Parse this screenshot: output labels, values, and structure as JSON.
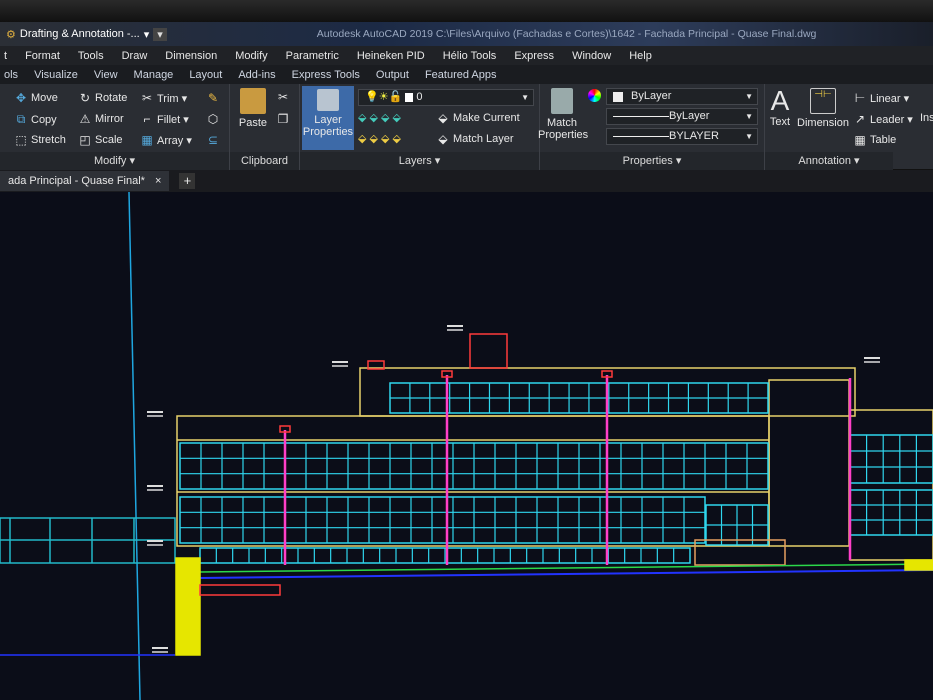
{
  "workspace": {
    "name": "Drafting & Annotation -..."
  },
  "window_title": "Autodesk AutoCAD 2019    C:\\Files\\Arquivo (Fachadas e Cortes)\\1642 - Fachada Principal - Quase Final.dwg",
  "menu": [
    "t",
    "Format",
    "Tools",
    "Draw",
    "Dimension",
    "Modify",
    "Parametric",
    "Heineken PID",
    "Hélio Tools",
    "Express",
    "Window",
    "Help"
  ],
  "ribbon_tabs": [
    "ols",
    "Visualize",
    "View",
    "Manage",
    "Layout",
    "Add-ins",
    "Express Tools",
    "Output",
    "Featured Apps"
  ],
  "modify": {
    "label": "Modify ▾",
    "move": "Move",
    "rotate": "Rotate",
    "trim": "Trim ▾",
    "copy": "Copy",
    "mirror": "Mirror",
    "fillet": "Fillet ▾",
    "stretch": "Stretch",
    "scale": "Scale",
    "array": "Array ▾"
  },
  "clipboard": {
    "label": "Clipboard",
    "paste": "Paste"
  },
  "layers": {
    "label": "Layers ▾",
    "layer_properties": "Layer Properties",
    "current_layer": "0",
    "make_current": "Make Current",
    "match_layer": "Match Layer"
  },
  "properties": {
    "label": "Properties ▾",
    "match_properties": "Match Properties",
    "color": "ByLayer",
    "linetype": "ByLayer",
    "lineweight": "BYLAYER"
  },
  "annotation": {
    "label": "Annotation ▾",
    "text": "Text",
    "dimension": "Dimension",
    "linear": "Linear ▾",
    "leader": "Leader ▾",
    "table": "Table",
    "insert": "Ins"
  },
  "document_tab": {
    "name": "ada Principal - Quase Final*",
    "close": "×",
    "new": "+"
  },
  "colors": {
    "window": "#2fd6ee",
    "outline": "#e8d26a",
    "column": "#ff3fc8",
    "roof": "#ff3b3b",
    "ground": "#2233ff",
    "axis": "#1fa6e0",
    "fence": "#23b8c8",
    "wall": "#e6e600"
  }
}
